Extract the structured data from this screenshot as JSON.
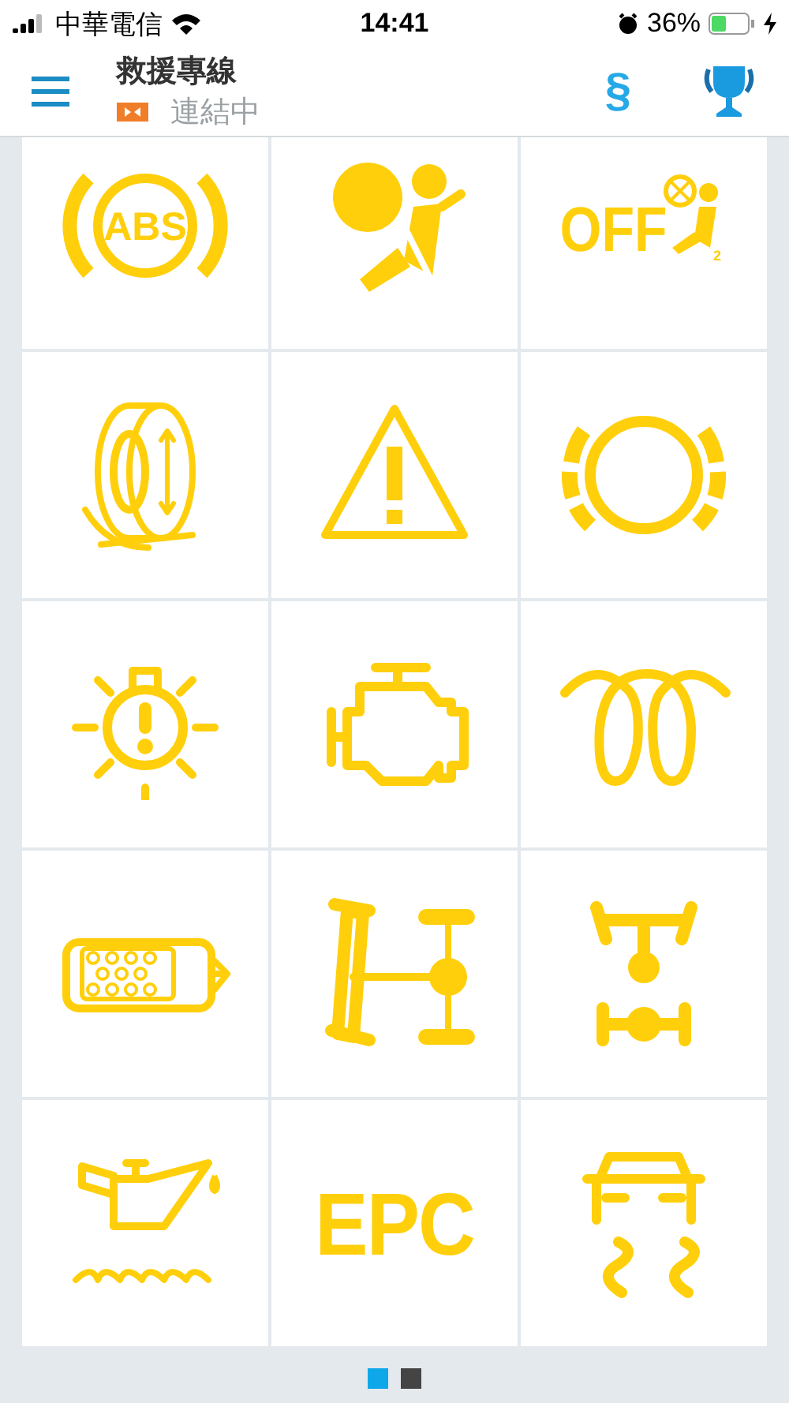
{
  "status_bar": {
    "carrier": "中華電信",
    "time": "14:41",
    "battery": "36%"
  },
  "header": {
    "title": "救援專線",
    "status": "連結中",
    "symbol": "§"
  },
  "tiles": [
    {
      "kind": "abs",
      "text": "ABS"
    },
    {
      "kind": "airbag"
    },
    {
      "kind": "airbag-off",
      "text": "OFF",
      "sub": "2"
    },
    {
      "kind": "tire-pressure"
    },
    {
      "kind": "warning"
    },
    {
      "kind": "brake-pad"
    },
    {
      "kind": "bulb"
    },
    {
      "kind": "engine"
    },
    {
      "kind": "glow-plug"
    },
    {
      "kind": "filter"
    },
    {
      "kind": "axle-side"
    },
    {
      "kind": "axle-top"
    },
    {
      "kind": "oil"
    },
    {
      "kind": "epc",
      "text": "EPC"
    },
    {
      "kind": "traction"
    }
  ],
  "pager": [
    {
      "selected": true
    },
    {
      "selected": false
    }
  ]
}
